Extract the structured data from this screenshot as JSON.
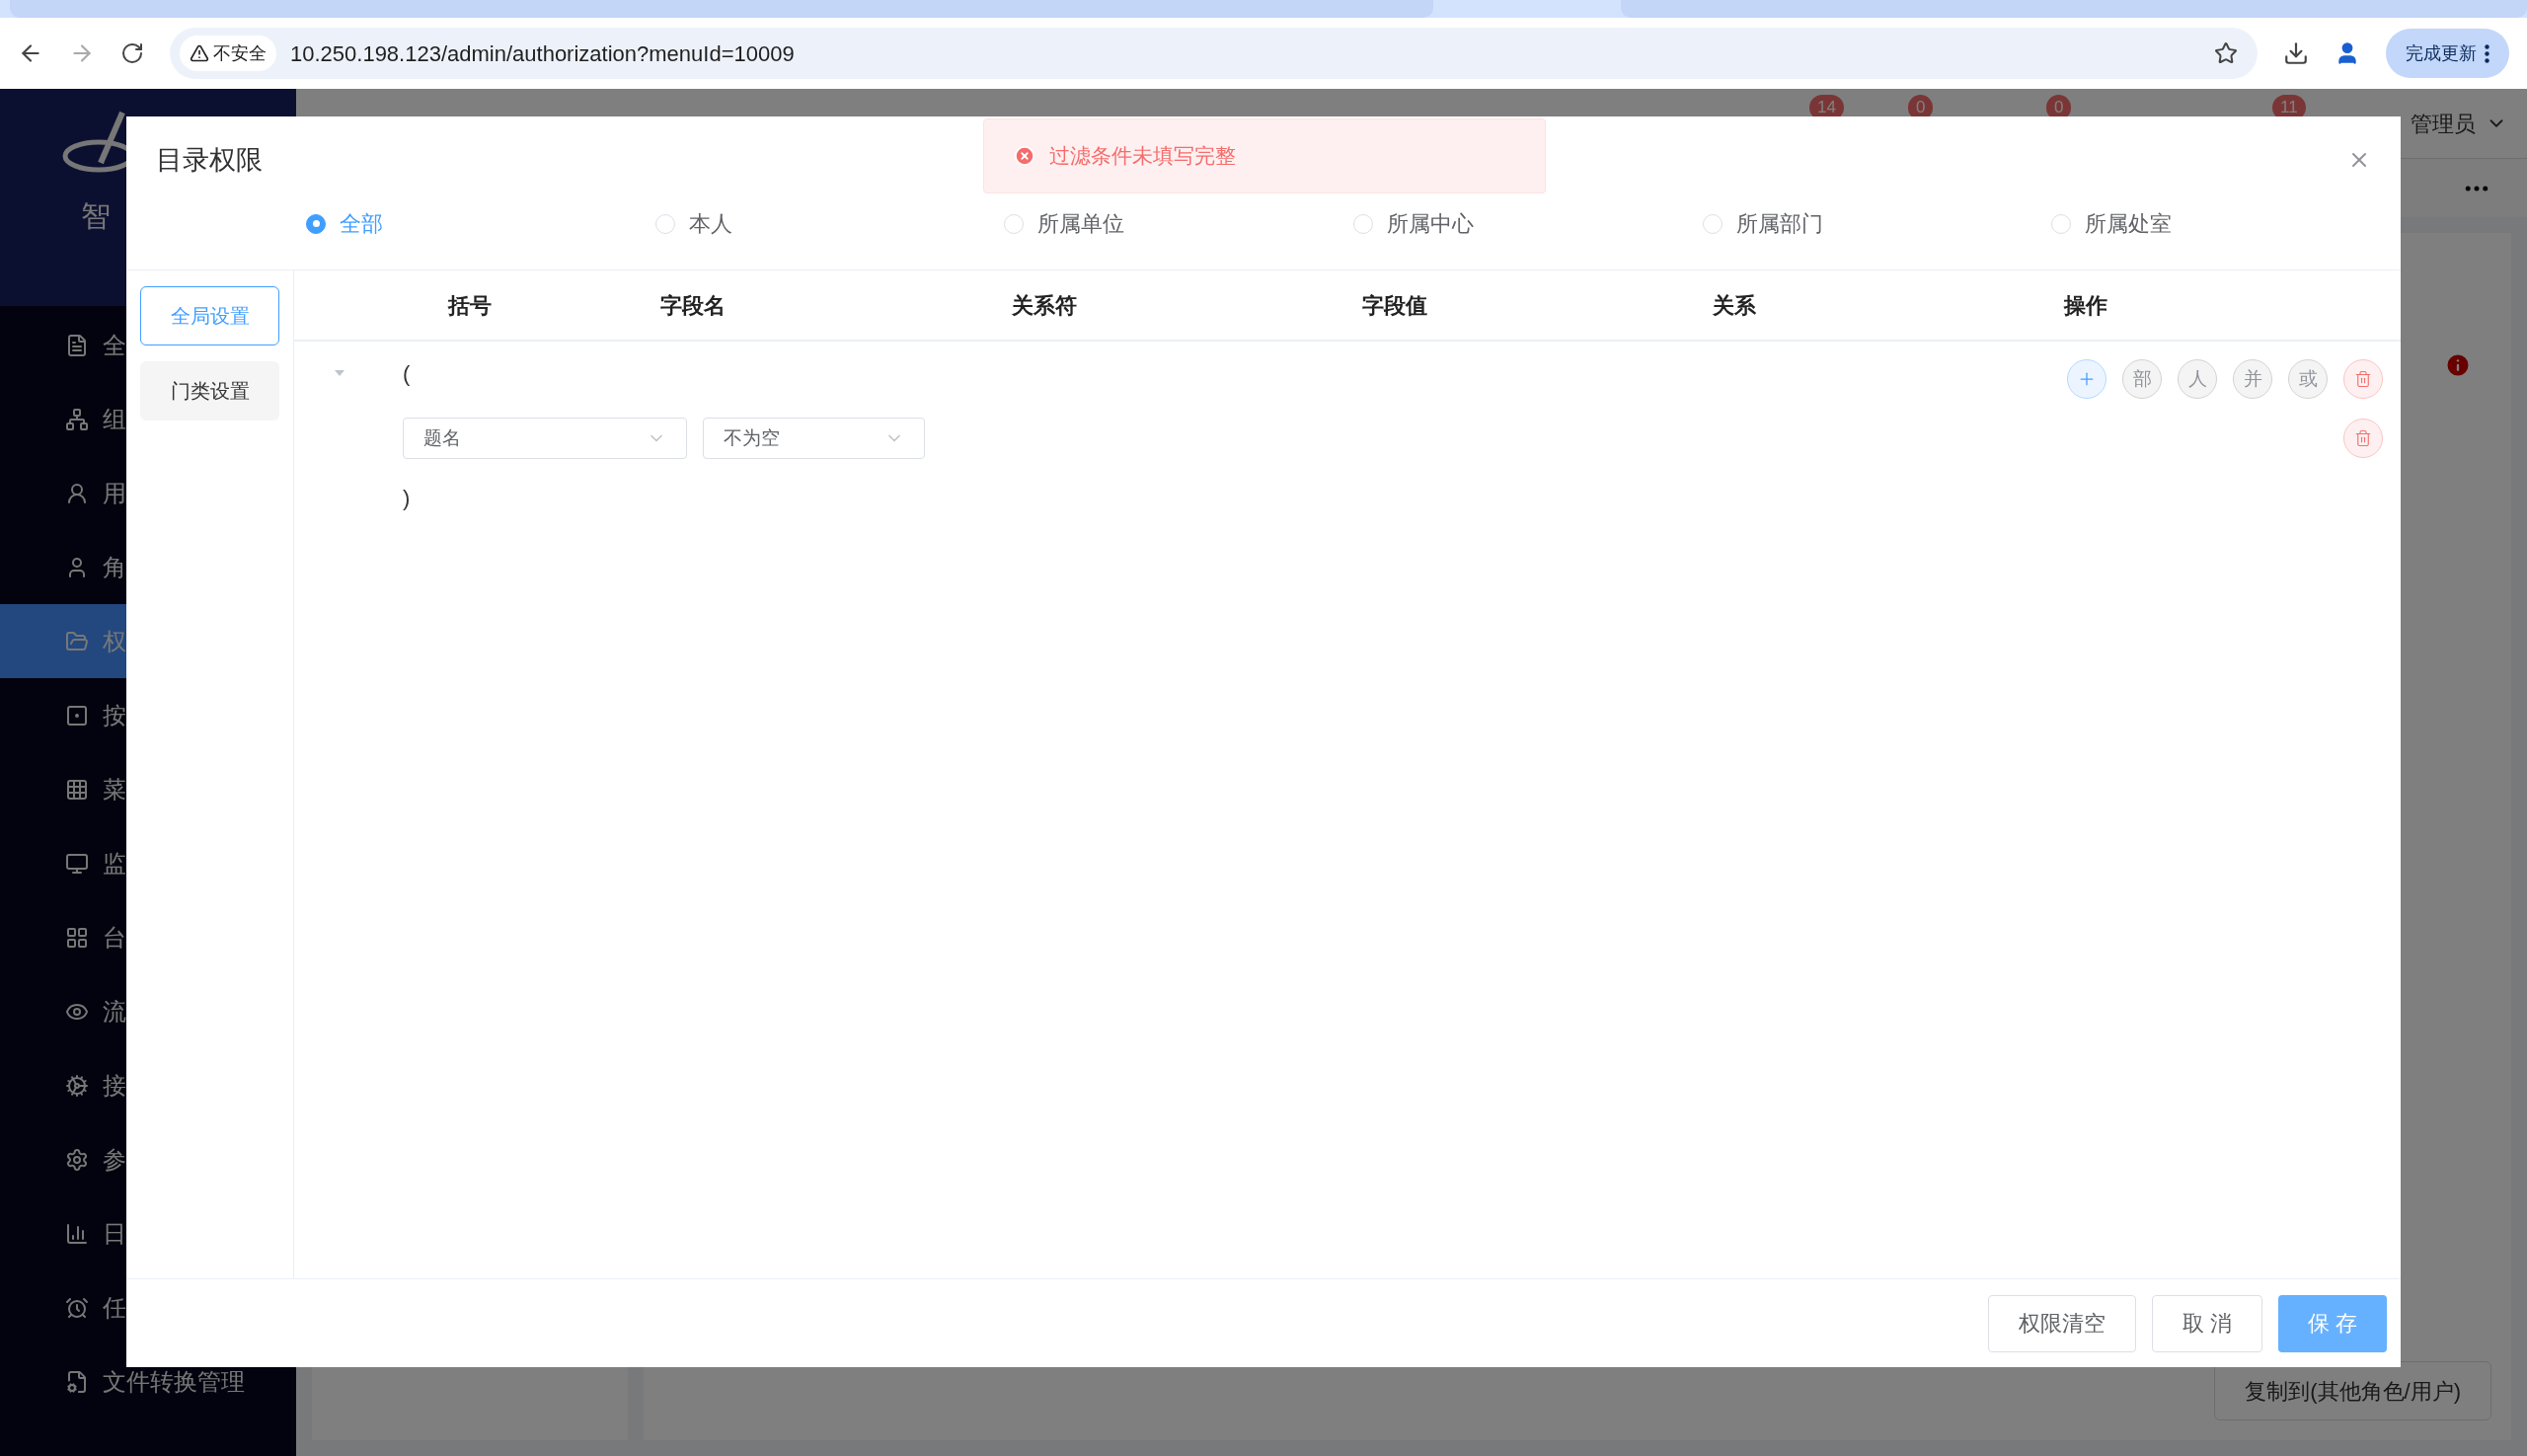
{
  "browser": {
    "security_label": "不安全",
    "url": "10.250.198.123/admin/authorization?menuId=10009",
    "update_button": "完成更新"
  },
  "sidebar": {
    "logo_text": "智",
    "items": [
      {
        "label": "全",
        "selected": false
      },
      {
        "label": "组",
        "selected": false
      },
      {
        "label": "用",
        "selected": false
      },
      {
        "label": "角",
        "selected": false
      },
      {
        "label": "权",
        "selected": true
      },
      {
        "label": "按",
        "selected": false
      },
      {
        "label": "菜",
        "selected": false
      },
      {
        "label": "监",
        "selected": false
      },
      {
        "label": "台",
        "selected": false
      },
      {
        "label": "流",
        "selected": false
      },
      {
        "label": "接",
        "selected": false
      },
      {
        "label": "参",
        "selected": false
      },
      {
        "label": "日",
        "selected": false
      },
      {
        "label": "任",
        "selected": false
      },
      {
        "label": "文件转换管理",
        "selected": false
      }
    ]
  },
  "header": {
    "badges": [
      "14",
      "0",
      "0",
      "11"
    ],
    "user": "管理员"
  },
  "copy_button": "复制到(其他角色/用户)",
  "dialog": {
    "title": "目录权限",
    "toast": "过滤条件未填写完整",
    "scopes": [
      {
        "label": "全部",
        "selected": true
      },
      {
        "label": "本人",
        "selected": false
      },
      {
        "label": "所属单位",
        "selected": false
      },
      {
        "label": "所属中心",
        "selected": false
      },
      {
        "label": "所属部门",
        "selected": false
      },
      {
        "label": "所属处室",
        "selected": false
      }
    ],
    "side_tabs": [
      {
        "label": "全局设置",
        "selected": true
      },
      {
        "label": "门类设置",
        "selected": false
      }
    ],
    "columns": [
      "括号",
      "字段名",
      "关系符",
      "字段值",
      "关系",
      "操作"
    ],
    "rows": [
      {
        "kind": "open",
        "text": "(",
        "expanded": true,
        "actions": [
          {
            "kind": "add"
          },
          {
            "kind": "text",
            "label": "部"
          },
          {
            "kind": "text",
            "label": "人"
          },
          {
            "kind": "text",
            "label": "并"
          },
          {
            "kind": "text",
            "label": "或"
          },
          {
            "kind": "delete"
          }
        ]
      },
      {
        "kind": "condition",
        "field": "题名",
        "operator": "不为空",
        "actions": [
          {
            "kind": "delete"
          }
        ]
      },
      {
        "kind": "close",
        "text": ")"
      }
    ],
    "buttons": [
      {
        "kind": "default",
        "label": "权限清空"
      },
      {
        "kind": "default",
        "label": "取 消"
      },
      {
        "kind": "primary",
        "label": "保 存"
      }
    ]
  }
}
